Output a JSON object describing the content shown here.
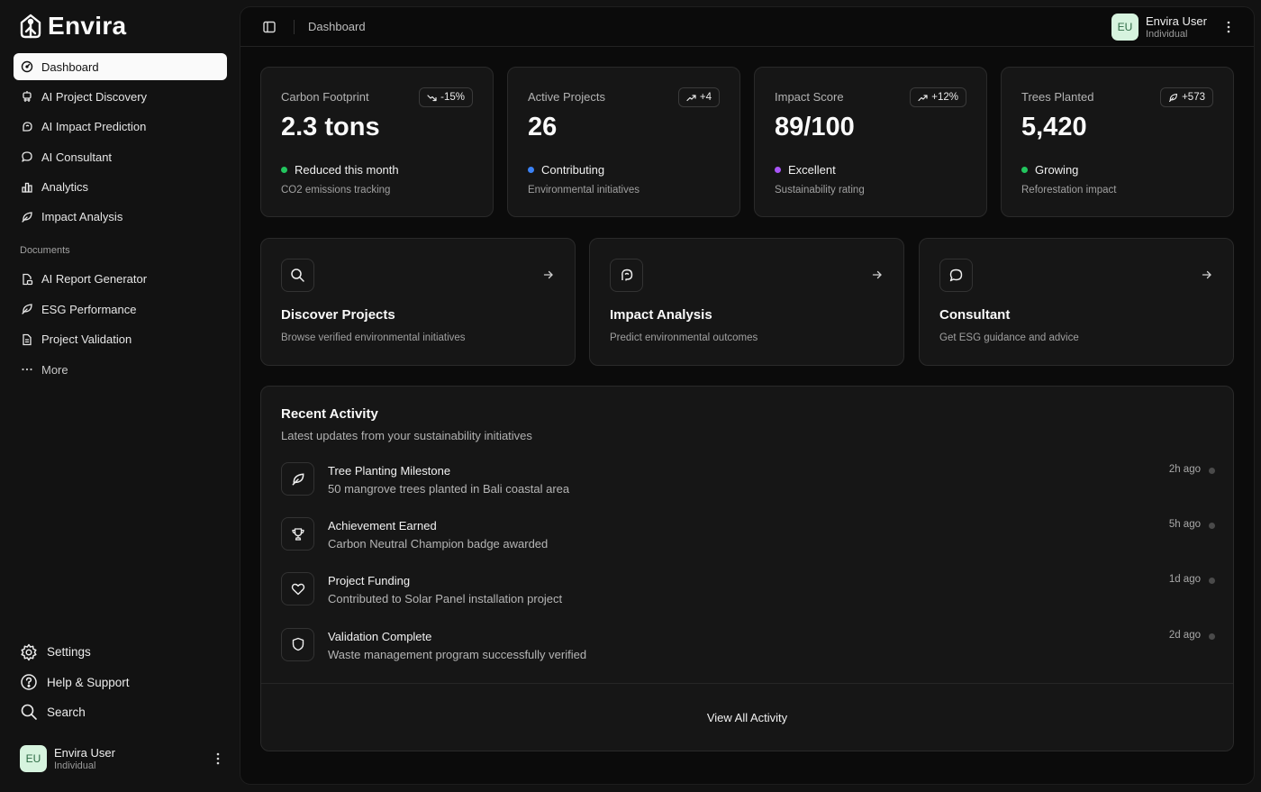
{
  "app": {
    "name": "Envira"
  },
  "sidebar": {
    "nav": [
      {
        "label": "Dashboard",
        "icon": "gauge-icon"
      },
      {
        "label": "AI Project Discovery",
        "icon": "bot-icon"
      },
      {
        "label": "AI Impact Prediction",
        "icon": "brain-icon"
      },
      {
        "label": "AI Consultant",
        "icon": "chat-icon"
      },
      {
        "label": "Analytics",
        "icon": "bar-chart-icon"
      },
      {
        "label": "Impact Analysis",
        "icon": "leaf-icon"
      }
    ],
    "section_label": "Documents",
    "docs": [
      {
        "label": "AI Report Generator",
        "icon": "file-bot-icon"
      },
      {
        "label": "ESG Performance",
        "icon": "leaf-icon"
      },
      {
        "label": "Project Validation",
        "icon": "file-icon"
      }
    ],
    "more_label": "More",
    "bottom": [
      {
        "label": "Settings",
        "icon": "gear-icon"
      },
      {
        "label": "Help & Support",
        "icon": "help-icon"
      },
      {
        "label": "Search",
        "icon": "search-icon"
      }
    ],
    "user": {
      "initials": "EU",
      "name": "Envira User",
      "role": "Individual"
    }
  },
  "header": {
    "breadcrumb": "Dashboard",
    "user": {
      "initials": "EU",
      "name": "Envira User",
      "role": "Individual"
    }
  },
  "stats": [
    {
      "label": "Carbon Footprint",
      "badge": "-15%",
      "badge_icon": "trend-down-icon",
      "value": "2.3 tons",
      "status": "Reduced this month",
      "dot_color": "#22c55e",
      "sub": "CO2 emissions tracking"
    },
    {
      "label": "Active Projects",
      "badge": "+4",
      "badge_icon": "trend-up-icon",
      "value": "26",
      "status": "Contributing",
      "dot_color": "#3b82f6",
      "sub": "Environmental initiatives"
    },
    {
      "label": "Impact Score",
      "badge": "+12%",
      "badge_icon": "trend-up-icon",
      "value": "89/100",
      "status": "Excellent",
      "dot_color": "#a855f7",
      "sub": "Sustainability rating"
    },
    {
      "label": "Trees Planted",
      "badge": "+573",
      "badge_icon": "leaf-icon",
      "value": "5,420",
      "status": "Growing",
      "dot_color": "#22c55e",
      "sub": "Reforestation impact"
    }
  ],
  "actions": [
    {
      "title": "Discover Projects",
      "sub": "Browse verified environmental initiatives",
      "icon": "search-icon"
    },
    {
      "title": "Impact Analysis",
      "sub": "Predict environmental outcomes",
      "icon": "brain-icon"
    },
    {
      "title": "Consultant",
      "sub": "Get ESG guidance and advice",
      "icon": "chat-icon"
    }
  ],
  "activity": {
    "title": "Recent Activity",
    "subtitle": "Latest updates from your sustainability initiatives",
    "items": [
      {
        "title": "Tree Planting Milestone",
        "desc": "50 mangrove trees planted in Bali coastal area",
        "time": "2h ago",
        "icon": "leaf-icon"
      },
      {
        "title": "Achievement Earned",
        "desc": "Carbon Neutral Champion badge awarded",
        "time": "5h ago",
        "icon": "trophy-icon"
      },
      {
        "title": "Project Funding",
        "desc": "Contributed to Solar Panel installation project",
        "time": "1d ago",
        "icon": "heart-icon"
      },
      {
        "title": "Validation Complete",
        "desc": "Waste management program successfully verified",
        "time": "2d ago",
        "icon": "shield-icon"
      }
    ],
    "view_all": "View All Activity"
  }
}
